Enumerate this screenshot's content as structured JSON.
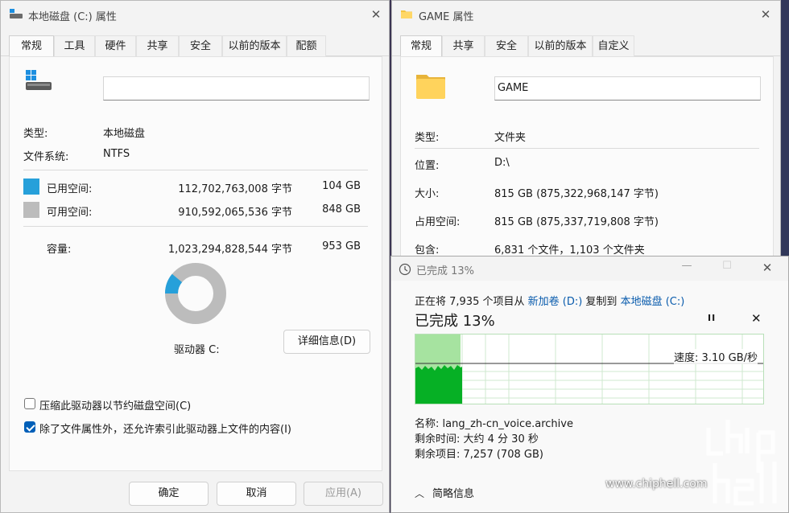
{
  "drive_window": {
    "title": "本地磁盘 (C:) 属性",
    "tabs": [
      "常规",
      "工具",
      "硬件",
      "共享",
      "安全",
      "以前的版本",
      "配额"
    ],
    "name_value": "",
    "type_label": "类型:",
    "type_value": "本地磁盘",
    "fs_label": "文件系统:",
    "fs_value": "NTFS",
    "used_label": "已用空间:",
    "used_bytes": "112,702,763,008 字节",
    "used_gb": "104 GB",
    "free_label": "可用空间:",
    "free_bytes": "910,592,065,536 字节",
    "free_gb": "848 GB",
    "capacity_label": "容量:",
    "capacity_bytes": "1,023,294,828,544 字节",
    "capacity_gb": "953 GB",
    "used_fraction": 0.11,
    "drive_label": "驱动器 C:",
    "details_button": "详细信息(D)",
    "compress_label": "压缩此驱动器以节约磁盘空间(C)",
    "index_label": "除了文件属性外，还允许索引此驱动器上文件的内容(I)",
    "compress_checked": false,
    "index_checked": true,
    "ok_button": "确定",
    "cancel_button": "取消",
    "apply_button": "应用(A)",
    "used_color": "#26a0da",
    "free_color": "#bcbcbc"
  },
  "folder_window": {
    "title": "GAME 属性",
    "tabs": [
      "常规",
      "共享",
      "安全",
      "以前的版本",
      "自定义"
    ],
    "name_value": "GAME",
    "type_label": "类型:",
    "type_value": "文件夹",
    "location_label": "位置:",
    "location_value": "D:\\",
    "size_label": "大小:",
    "size_value": "815 GB (875,322,968,147 字节)",
    "disk_size_label": "占用空间:",
    "disk_size_value": "815 GB (875,337,719,808 字节)",
    "contains_label": "包含:",
    "contains_value": "6,831 个文件，1,103 个文件夹"
  },
  "copy_window": {
    "title": "已完成 13%",
    "status_prefix": "正在将 7,935 个项目从 ",
    "source": "新加卷 (D:)",
    "status_middle": " 复制到 ",
    "destination": "本地磁盘 (C:)",
    "headline": "已完成 13%",
    "progress_percent": 13,
    "speed": "速度: 3.10 GB/秒",
    "name_line": "名称:  lang_zh-cn_voice.archive",
    "time_line": "剩余时间:  大约 4 分 30 秒",
    "items_line": "剩余项目:  7,257 (708 GB)",
    "less_details": "简略信息",
    "pause_glyph": "II",
    "close_glyph": "✕"
  },
  "watermark": {
    "text": "www.chiphell.com",
    "logo": "chip hell"
  }
}
